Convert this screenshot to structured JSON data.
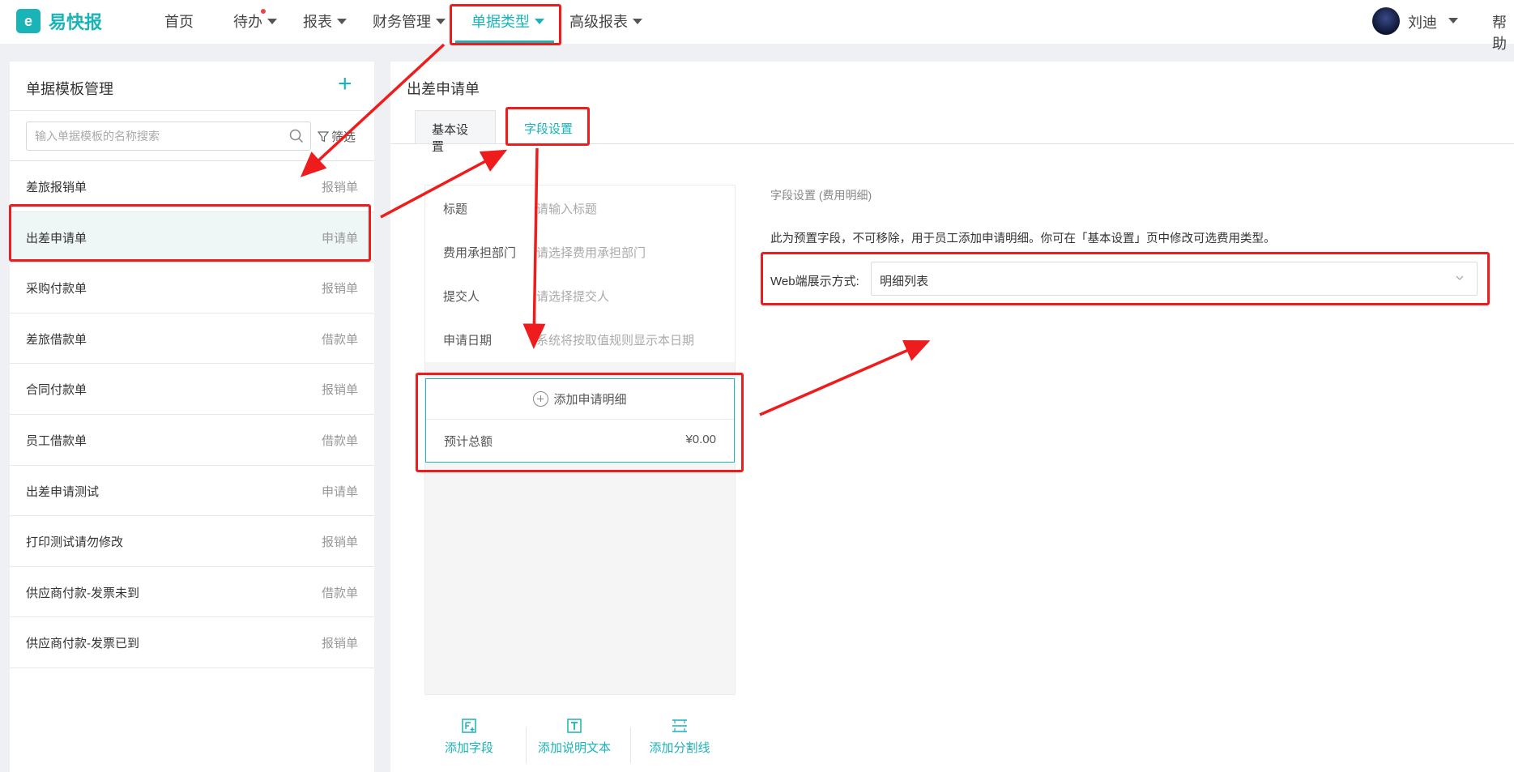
{
  "app": {
    "name": "易快报",
    "logo_glyph": "e",
    "brand_color": "#1ab3b7"
  },
  "nav": {
    "items": [
      {
        "label": "首页",
        "has_caret": false
      },
      {
        "label": "待办",
        "has_caret": true,
        "badge_dot": true
      },
      {
        "label": "报表",
        "has_caret": true
      },
      {
        "label": "财务管理",
        "has_caret": true
      },
      {
        "label": "单据类型",
        "has_caret": true,
        "active": true
      },
      {
        "label": "高级报表",
        "has_caret": true
      }
    ],
    "user": "刘迪",
    "help": "帮助"
  },
  "left_panel": {
    "title": "单据模板管理",
    "add_icon": "plus-icon",
    "search_placeholder": "输入单据模板的名称搜索",
    "filter_label": "筛选",
    "items": [
      {
        "name": "差旅报销单",
        "type": "报销单"
      },
      {
        "name": "出差申请单",
        "type": "申请单",
        "selected": true
      },
      {
        "name": "采购付款单",
        "type": "报销单"
      },
      {
        "name": "差旅借款单",
        "type": "借款单"
      },
      {
        "name": "合同付款单",
        "type": "报销单"
      },
      {
        "name": "员工借款单",
        "type": "借款单"
      },
      {
        "name": "出差申请测试",
        "type": "申请单"
      },
      {
        "name": "打印测试请勿修改",
        "type": "报销单"
      },
      {
        "name": "供应商付款-发票未到",
        "type": "借款单"
      },
      {
        "name": "供应商付款-发票已到",
        "type": "报销单"
      }
    ]
  },
  "right_panel": {
    "title": "出差申请单",
    "tabs": [
      {
        "label": "基本设置"
      },
      {
        "label": "字段设置",
        "active": true
      }
    ],
    "form_fields": [
      {
        "label": "标题",
        "placeholder": "请输入标题"
      },
      {
        "label": "费用承担部门",
        "placeholder": "请选择费用承担部门"
      },
      {
        "label": "提交人",
        "placeholder": "请选择提交人"
      },
      {
        "label": "申请日期",
        "placeholder": "系统将按取值规则显示本日期"
      }
    ],
    "detail": {
      "add_label": "添加申请明细",
      "total_label": "预计总额",
      "total_value": "¥0.00"
    },
    "tools": [
      {
        "label": "添加字段"
      },
      {
        "label": "添加说明文本"
      },
      {
        "label": "添加分割线"
      }
    ],
    "settings": {
      "title": "字段设置 (费用明细)",
      "description": "此为预置字段，不可移除，用于员工添加申请明细。你可在「基本设置」页中修改可选费用类型。",
      "web_display_label": "Web端展示方式:",
      "web_display_value": "明细列表"
    }
  },
  "annotation_color": "#ee1c1c"
}
